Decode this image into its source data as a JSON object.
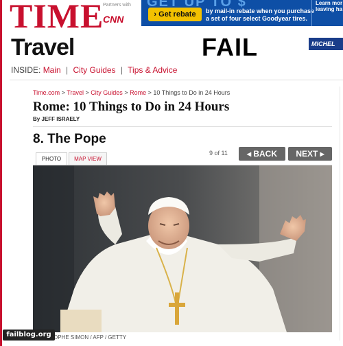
{
  "brand": {
    "logo": "TIME",
    "partners_label": "Partners with",
    "partner_logo": "CNN"
  },
  "ad": {
    "top_text": "GET UP TO $",
    "rebate_button": "Get rebate",
    "offer_line1": "by mail-in rebate when you purchase",
    "offer_line2": "a set of four select Goodyear tires.",
    "right_line1": "Learn mor",
    "right_line2": "leaving ha",
    "sponsor": "MICHEL"
  },
  "overlay": {
    "fail": "FAIL",
    "watermark": "failblog.org"
  },
  "section": {
    "title": "Travel",
    "inside_label": "INSIDE:",
    "links": [
      "Main",
      "City Guides",
      "Tips & Advice"
    ]
  },
  "breadcrumb": {
    "items": [
      "Time.com",
      "Travel",
      "City Guides",
      "Rome"
    ],
    "current": "10 Things to Do in 24 Hours",
    "separator": ">"
  },
  "article": {
    "title": "Rome: 10 Things to Do in 24 Hours",
    "byline": "By JEFF ISRAELY",
    "item_title": "8. The Pope"
  },
  "gallery": {
    "tabs": [
      "PHOTO",
      "MAP VIEW"
    ],
    "position": "9 of 11",
    "back_label": "◂ BACK",
    "next_label": "NEXT ▸",
    "photo_credit": "OPHE SIMON / AFP / GETTY"
  },
  "colors": {
    "time_red": "#c8102e",
    "ad_blue": "#0e4fa6",
    "button_gray": "#666666"
  }
}
